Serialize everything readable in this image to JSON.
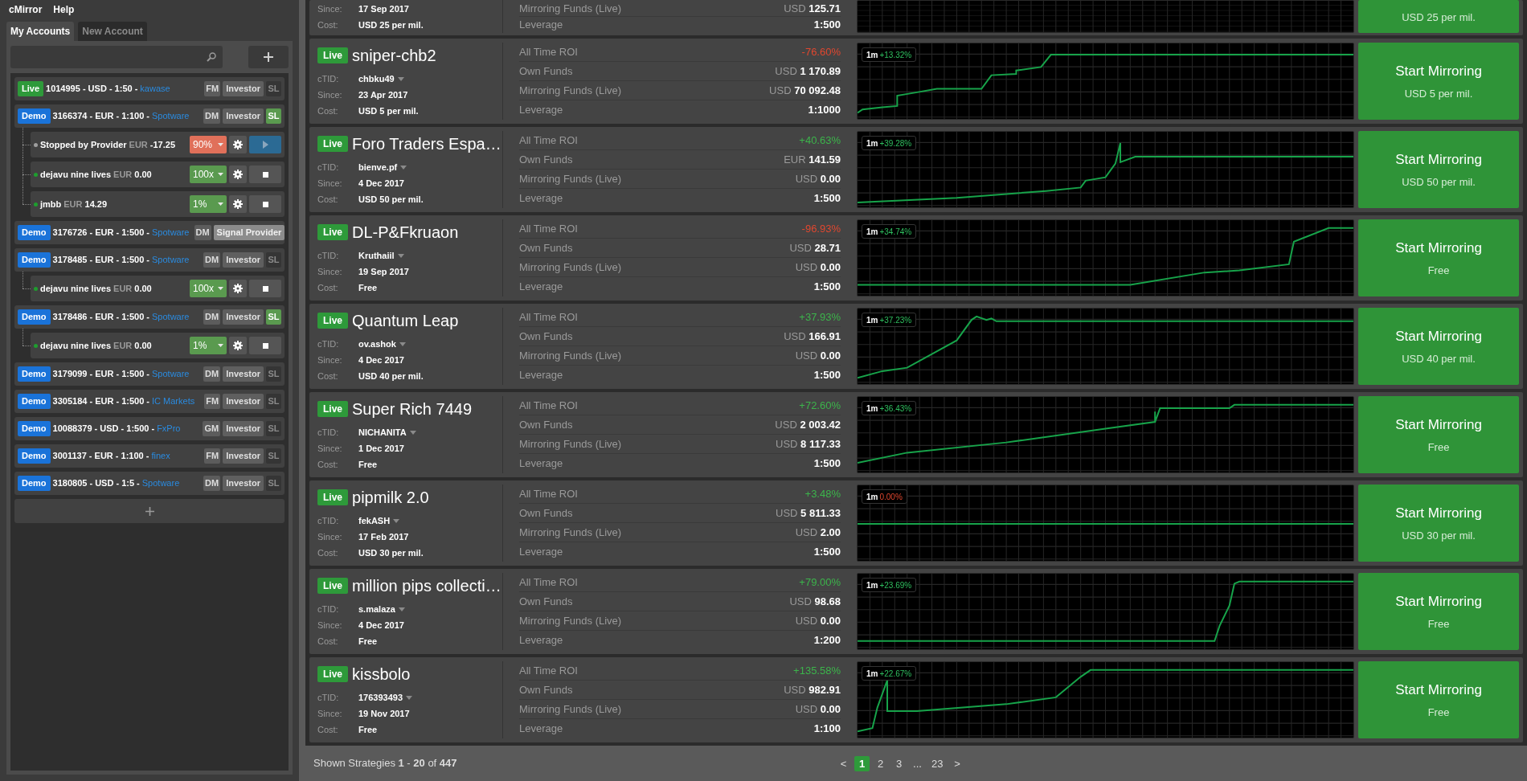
{
  "menu": [
    "cMirror",
    "Help"
  ],
  "tabs": [
    {
      "label": "My Accounts",
      "selected": true
    },
    {
      "label": "New Account",
      "selected": false
    }
  ],
  "accounts": [
    {
      "type": "Live",
      "details": "1014995 - USD - 1:50 -",
      "broker": "kawase",
      "manager": "FM",
      "role": "Investor",
      "sl_label": "SL",
      "sl_on": false
    },
    {
      "type": "Demo",
      "details": "3166374 - EUR - 1:100 -",
      "broker": "Spotware",
      "manager": "DM",
      "role": "Investor",
      "sl_label": "SL",
      "sl_on": true,
      "subscriptions": [
        {
          "name": "Stopped by Provider",
          "currency": "EUR",
          "amount": "-17.25",
          "color": "#9e9e9e",
          "ratio": "90%",
          "ratio_warning": true,
          "kind": "stopped"
        },
        {
          "name": "dejavu nine lives",
          "currency": "EUR",
          "amount": "0.00",
          "color": "#1e9e2e",
          "ratio": "100x",
          "ratio_warning": false,
          "kind": "running"
        },
        {
          "name": "jmbb",
          "currency": "EUR",
          "amount": "14.29",
          "color": "#1e9e2e",
          "ratio": "1%",
          "ratio_warning": false,
          "kind": "running"
        }
      ]
    },
    {
      "type": "Demo",
      "details": "3176726 - EUR - 1:500 -",
      "broker": "Spotware",
      "manager": "DM",
      "role": "Signal Provider"
    },
    {
      "type": "Demo",
      "details": "3178485 - EUR - 1:500 -",
      "broker": "Spotware",
      "manager": "DM",
      "role": "Investor",
      "sl_label": "SL",
      "sl_on": false,
      "subscriptions": [
        {
          "name": "dejavu nine lives",
          "currency": "EUR",
          "amount": "0.00",
          "color": "#1e9e2e",
          "ratio": "100x",
          "ratio_warning": false,
          "kind": "running"
        }
      ]
    },
    {
      "type": "Demo",
      "details": "3178486 - EUR - 1:500 -",
      "broker": "Spotware",
      "manager": "DM",
      "role": "Investor",
      "sl_label": "SL",
      "sl_on": true,
      "subscriptions": [
        {
          "name": "dejavu nine lives",
          "currency": "EUR",
          "amount": "0.00",
          "color": "#1e9e2e",
          "ratio": "1%",
          "ratio_warning": false,
          "kind": "running"
        }
      ]
    },
    {
      "type": "Demo",
      "details": "3179099 - EUR - 1:500 -",
      "broker": "Spotware",
      "manager": "DM",
      "role": "Investor",
      "sl_label": "SL",
      "sl_on": false
    },
    {
      "type": "Demo",
      "details": "3305184 - EUR - 1:500 -",
      "broker": "IC Markets",
      "manager": "FM",
      "role": "Investor",
      "sl_label": "SL",
      "sl_on": false
    },
    {
      "type": "Demo",
      "details": "10088379 - USD - 1:500 -",
      "broker": "FxPro",
      "manager": "GM",
      "role": "Investor",
      "sl_label": "SL",
      "sl_on": false
    },
    {
      "type": "Demo",
      "details": "3001137 - EUR - 1:100 -",
      "broker": "finex",
      "manager": "FM",
      "role": "Investor",
      "sl_label": "SL",
      "sl_on": false
    },
    {
      "type": "Demo",
      "details": "3180805 - USD - 1:5 -",
      "broker": "Spotware",
      "manager": "DM",
      "role": "Investor",
      "sl_label": "SL",
      "sl_on": false
    }
  ],
  "strategies": [
    {
      "info": [
        [
          "Since:",
          "17 Sep 2017"
        ],
        [
          "Cost:",
          "USD 25 per mil."
        ]
      ],
      "stats": [
        {
          "label": "Mirroring Funds (Live)",
          "currency": "USD",
          "value": "125.71"
        },
        {
          "label": "Leverage",
          "value": "1:500"
        }
      ],
      "button": {
        "sublabel": "USD 25 per mil."
      }
    },
    {
      "badge": "Live",
      "name": "sniper-chb2",
      "info": [
        [
          "cTID:",
          "chbku49"
        ],
        [
          "Since:",
          "23 Apr 2017"
        ],
        [
          "Cost:",
          "USD 5 per mil."
        ]
      ],
      "stats": [
        {
          "label": "All Time ROI",
          "value": "-76.60%",
          "negative": true
        },
        {
          "label": "Own Funds",
          "currency": "USD",
          "value": "1 170.89"
        },
        {
          "label": "Mirroring Funds (Live)",
          "currency": "USD",
          "value": "70 092.48"
        },
        {
          "label": "Leverage",
          "value": "1:1000"
        }
      ],
      "chart": {
        "period": "1m",
        "change": "+13.32%",
        "negative": false
      },
      "button": {
        "label": "Start Mirroring",
        "sublabel": "USD 5 per mil."
      }
    },
    {
      "badge": "Live",
      "name": "Foro Traders Espa…",
      "info": [
        [
          "cTID:",
          "bienve.pf"
        ],
        [
          "Since:",
          "4 Dec 2017"
        ],
        [
          "Cost:",
          "USD 50 per mil."
        ]
      ],
      "stats": [
        {
          "label": "All Time ROI",
          "value": "+40.63%",
          "negative": false
        },
        {
          "label": "Own Funds",
          "currency": "EUR",
          "value": "141.59"
        },
        {
          "label": "Mirroring Funds (Live)",
          "currency": "USD",
          "value": "0.00"
        },
        {
          "label": "Leverage",
          "value": "1:500"
        }
      ],
      "chart": {
        "period": "1m",
        "change": "+39.28%",
        "negative": false
      },
      "button": {
        "label": "Start Mirroring",
        "sublabel": "USD 50 per mil."
      }
    },
    {
      "badge": "Live",
      "name": "DL-P&Fkruaon",
      "info": [
        [
          "cTID:",
          "Kruthaiil"
        ],
        [
          "Since:",
          "19 Sep 2017"
        ],
        [
          "Cost:",
          "Free"
        ]
      ],
      "stats": [
        {
          "label": "All Time ROI",
          "value": "-96.93%",
          "negative": true
        },
        {
          "label": "Own Funds",
          "currency": "USD",
          "value": "28.71"
        },
        {
          "label": "Mirroring Funds (Live)",
          "currency": "USD",
          "value": "0.00"
        },
        {
          "label": "Leverage",
          "value": "1:500"
        }
      ],
      "chart": {
        "period": "1m",
        "change": "+34.74%",
        "negative": false
      },
      "button": {
        "label": "Start Mirroring",
        "sublabel": "Free"
      }
    },
    {
      "badge": "Live",
      "name": "Quantum Leap",
      "info": [
        [
          "cTID:",
          "ov.ashok"
        ],
        [
          "Since:",
          "4 Dec 2017"
        ],
        [
          "Cost:",
          "USD 40 per mil."
        ]
      ],
      "stats": [
        {
          "label": "All Time ROI",
          "value": "+37.93%",
          "negative": false
        },
        {
          "label": "Own Funds",
          "currency": "USD",
          "value": "166.91"
        },
        {
          "label": "Mirroring Funds (Live)",
          "currency": "USD",
          "value": "0.00"
        },
        {
          "label": "Leverage",
          "value": "1:500"
        }
      ],
      "chart": {
        "period": "1m",
        "change": "+37.23%",
        "negative": false
      },
      "button": {
        "label": "Start Mirroring",
        "sublabel": "USD 40 per mil."
      }
    },
    {
      "badge": "Live",
      "name": "Super Rich 7449",
      "info": [
        [
          "cTID:",
          "NICHANITA"
        ],
        [
          "Since:",
          "1 Dec 2017"
        ],
        [
          "Cost:",
          "Free"
        ]
      ],
      "stats": [
        {
          "label": "All Time ROI",
          "value": "+72.60%",
          "negative": false
        },
        {
          "label": "Own Funds",
          "currency": "USD",
          "value": "2 003.42"
        },
        {
          "label": "Mirroring Funds (Live)",
          "currency": "USD",
          "value": "8 117.33"
        },
        {
          "label": "Leverage",
          "value": "1:500"
        }
      ],
      "chart": {
        "period": "1m",
        "change": "+36.43%",
        "negative": false
      },
      "button": {
        "label": "Start Mirroring",
        "sublabel": "Free"
      }
    },
    {
      "badge": "Live",
      "name": "pipmilk 2.0",
      "info": [
        [
          "cTID:",
          "fekASH"
        ],
        [
          "Since:",
          "17 Feb 2017"
        ],
        [
          "Cost:",
          "USD 30 per mil."
        ]
      ],
      "stats": [
        {
          "label": "All Time ROI",
          "value": "+3.48%",
          "negative": false
        },
        {
          "label": "Own Funds",
          "currency": "USD",
          "value": "5 811.33"
        },
        {
          "label": "Mirroring Funds (Live)",
          "currency": "USD",
          "value": "2.00"
        },
        {
          "label": "Leverage",
          "value": "1:500"
        }
      ],
      "chart": {
        "period": "1m",
        "change": "0.00%",
        "negative": true
      },
      "button": {
        "label": "Start Mirroring",
        "sublabel": "USD 30 per mil."
      }
    },
    {
      "badge": "Live",
      "name": "million pips collecti…",
      "info": [
        [
          "cTID:",
          "s.malaza"
        ],
        [
          "Since:",
          "4 Dec 2017"
        ],
        [
          "Cost:",
          "Free"
        ]
      ],
      "stats": [
        {
          "label": "All Time ROI",
          "value": "+79.00%",
          "negative": false
        },
        {
          "label": "Own Funds",
          "currency": "USD",
          "value": "98.68"
        },
        {
          "label": "Mirroring Funds (Live)",
          "currency": "USD",
          "value": "0.00"
        },
        {
          "label": "Leverage",
          "value": "1:200"
        }
      ],
      "chart": {
        "period": "1m",
        "change": "+23.69%",
        "negative": false
      },
      "button": {
        "label": "Start Mirroring",
        "sublabel": "Free"
      }
    },
    {
      "badge": "Live",
      "name": "kissbolo",
      "info": [
        [
          "cTID:",
          "176393493"
        ],
        [
          "Since:",
          "19 Nov 2017"
        ],
        [
          "Cost:",
          "Free"
        ]
      ],
      "stats": [
        {
          "label": "All Time ROI",
          "value": "+135.58%",
          "negative": false
        },
        {
          "label": "Own Funds",
          "currency": "USD",
          "value": "982.91"
        },
        {
          "label": "Mirroring Funds (Live)",
          "currency": "USD",
          "value": "0.00"
        },
        {
          "label": "Leverage",
          "value": "1:100"
        }
      ],
      "chart": {
        "period": "1m",
        "change": "+22.67%",
        "negative": false
      },
      "button": {
        "label": "Start Mirroring",
        "sublabel": "Free"
      }
    }
  ],
  "pagination": {
    "summary": "Shown Strategies **1** - **20** of **447**",
    "pages": [
      {
        "label": "<",
        "selected": false
      },
      {
        "label": "1",
        "selected": true
      },
      {
        "label": "2",
        "selected": false
      },
      {
        "label": "3",
        "selected": false
      },
      {
        "label": "...",
        "selected": false
      },
      {
        "label": "23",
        "selected": false
      },
      {
        "label": ">",
        "selected": false
      }
    ]
  }
}
